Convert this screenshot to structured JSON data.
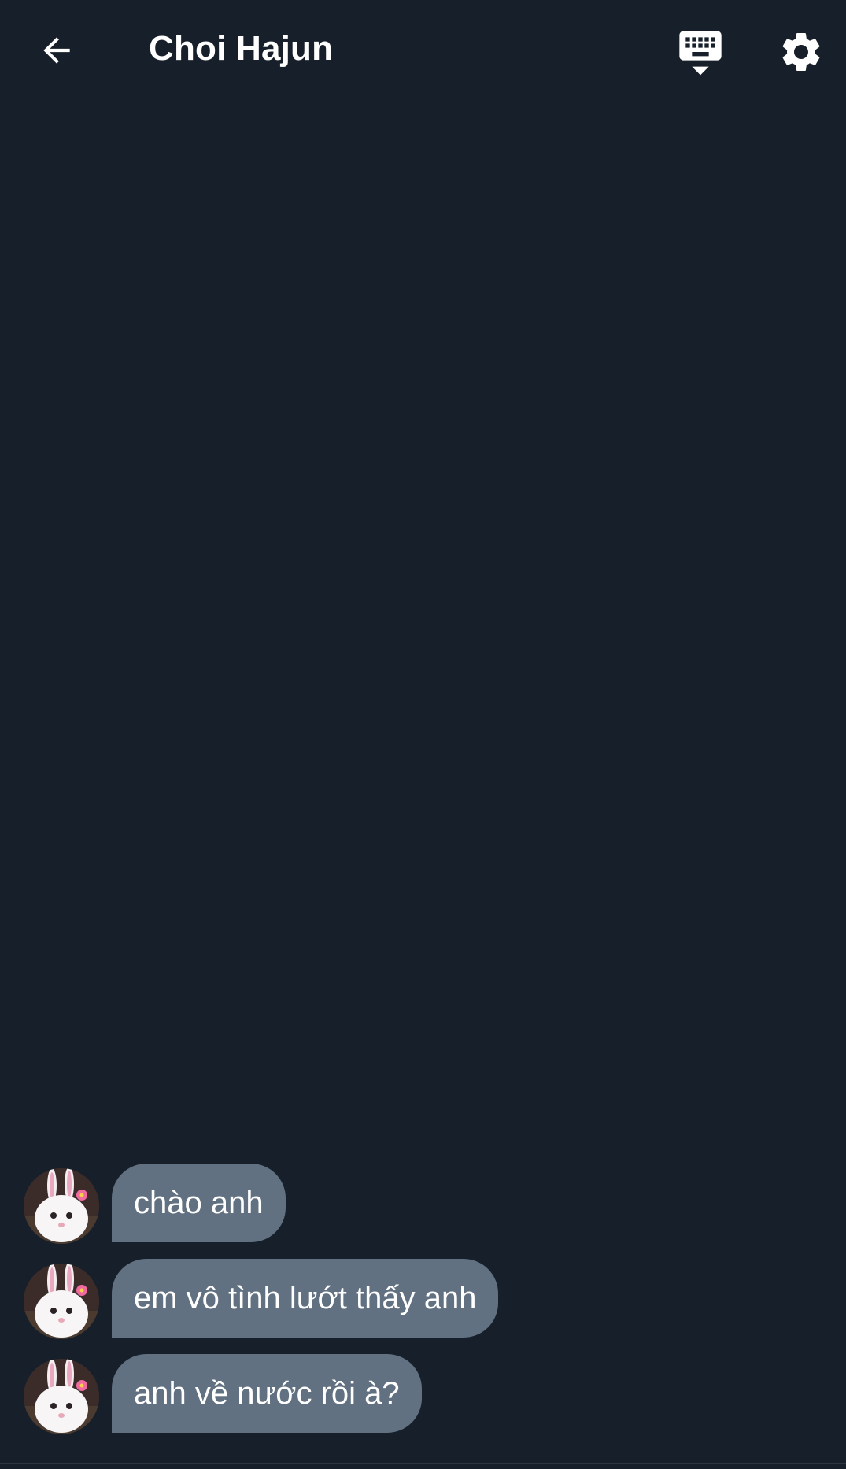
{
  "header": {
    "title": "Choi Hajun",
    "back_icon": "arrow-left-icon",
    "keyboard_icon": "keyboard-hide-icon",
    "settings_icon": "gear-icon"
  },
  "messages": [
    {
      "text": "chào anh",
      "sender": "incoming"
    },
    {
      "text": "em vô tình lướt thấy anh",
      "sender": "incoming"
    },
    {
      "text": "anh về nước rồi à?",
      "sender": "incoming"
    }
  ],
  "colors": {
    "background": "#17202a",
    "bubble": "#627181",
    "text": "#ffffff"
  }
}
